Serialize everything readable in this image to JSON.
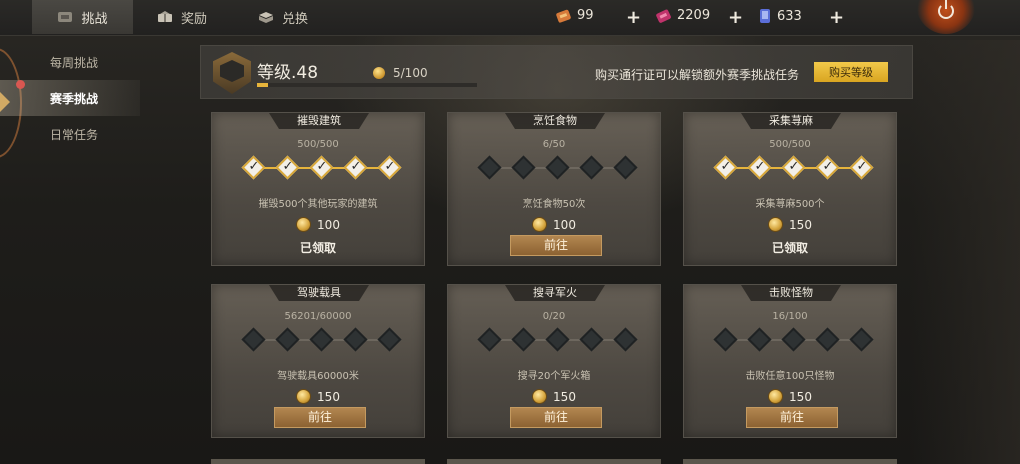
{
  "topbar": {
    "tabs": [
      {
        "label": "挑战",
        "icon": "challenge-icon",
        "active": true
      },
      {
        "label": "奖励",
        "icon": "gift-icon",
        "active": false
      },
      {
        "label": "兑换",
        "icon": "exchange-icon",
        "active": false
      }
    ],
    "resources": [
      {
        "icon": "ticket-icon",
        "value": "99"
      },
      {
        "icon": "pink-ticket-icon",
        "value": "2209"
      },
      {
        "icon": "phone-card-icon",
        "value": "633"
      }
    ],
    "plus": "+"
  },
  "sidebar": {
    "items": [
      {
        "label": "每周挑战",
        "active": false
      },
      {
        "label": "赛季挑战",
        "active": true
      },
      {
        "label": "日常任务",
        "active": false
      }
    ]
  },
  "level": {
    "label": "等级.48",
    "xp": "5/100",
    "progress": 0.05,
    "buy_text": "购买通行证可以解锁额外赛季挑战任务",
    "buy_button": "购买等级"
  },
  "cards": [
    {
      "title": "摧毁建筑",
      "progress": "500/500",
      "steps_done": 5,
      "desc": "摧毁500个其他玩家的建筑",
      "reward": "100",
      "status": "claimed",
      "status_label": "已领取"
    },
    {
      "title": "烹饪食物",
      "progress": "6/50",
      "steps_done": 0,
      "desc": "烹饪食物50次",
      "reward": "100",
      "status": "go",
      "status_label": "前往"
    },
    {
      "title": "采集荨麻",
      "progress": "500/500",
      "steps_done": 5,
      "desc": "采集荨麻500个",
      "reward": "150",
      "status": "claimed",
      "status_label": "已领取"
    },
    {
      "title": "驾驶载具",
      "progress": "56201/60000",
      "steps_done": 0,
      "desc": "驾驶载具60000米",
      "reward": "150",
      "status": "go",
      "status_label": "前往"
    },
    {
      "title": "搜寻军火",
      "progress": "0/20",
      "steps_done": 0,
      "desc": "搜寻20个军火箱",
      "reward": "150",
      "status": "go",
      "status_label": "前往"
    },
    {
      "title": "击败怪物",
      "progress": "16/100",
      "steps_done": 0,
      "desc": "击败任意100只怪物",
      "reward": "150",
      "status": "go",
      "status_label": "前往"
    }
  ],
  "colors": {
    "accent": "#e7b43b",
    "button": "#a07840",
    "alert": "#e02a2a"
  }
}
